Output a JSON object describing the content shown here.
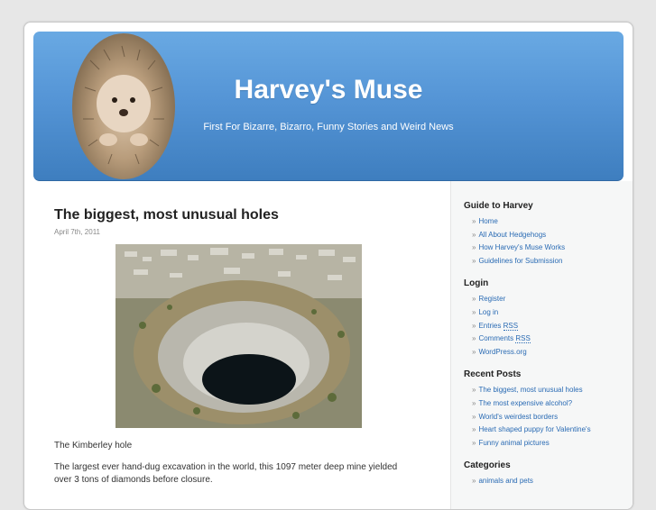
{
  "header": {
    "title": "Harvey's Muse",
    "description": "First For Bizarre, Bizarro, Funny Stories and Weird News"
  },
  "post": {
    "title": "The biggest, most unusual holes",
    "date": "April 7th, 2011",
    "caption": "The Kimberley hole",
    "body": "The largest ever hand-dug excavation in the world, this 1097 meter deep mine yielded over 3 tons of diamonds before closure."
  },
  "sidebar": {
    "guide": {
      "heading": "Guide to Harvey",
      "items": [
        "Home",
        "All About Hedgehogs",
        "How Harvey's Muse Works",
        "Guidelines for Submission"
      ]
    },
    "login": {
      "heading": "Login",
      "register": "Register",
      "login": "Log in",
      "entries": "Entries",
      "comments": "Comments",
      "rss": "RSS",
      "wordpress": "WordPress.org"
    },
    "recent": {
      "heading": "Recent Posts",
      "items": [
        "The biggest, most unusual holes",
        "The most expensive alcohol?",
        "World's weirdest borders",
        "Heart shaped puppy for Valentine's",
        "Funny animal pictures"
      ]
    },
    "categories": {
      "heading": "Categories",
      "items": [
        "animals and pets"
      ]
    }
  },
  "colors": {
    "header_top": "#69a9e3",
    "header_bottom": "#3e7ebf",
    "link": "#2a6bb4"
  },
  "icons": {
    "avatar": "hedgehog-photo"
  }
}
